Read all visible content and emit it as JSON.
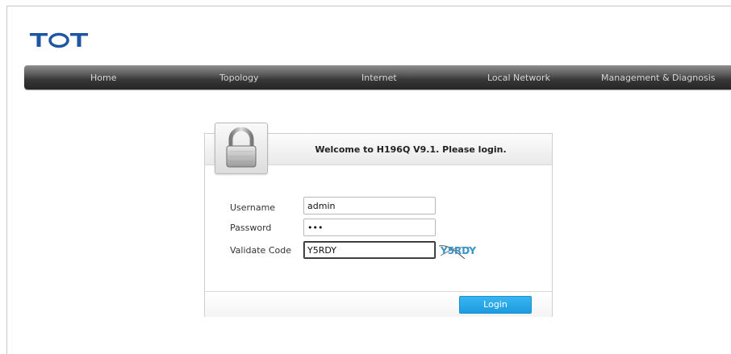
{
  "brand": {
    "logo_text": "TOT",
    "logo_color": "#1e56a3"
  },
  "nav": {
    "home": "Home",
    "topology": "Topology",
    "internet": "Internet",
    "local_network": "Local Network",
    "management": "Management & Diagnosis"
  },
  "login": {
    "title": "Welcome to H196Q V9.1. Please login.",
    "username_label": "Username",
    "username_value": "admin",
    "password_label": "Password",
    "password_value": "•••",
    "code_label": "Validate Code",
    "code_value": "Y5RDY",
    "captcha_text": "Y5RDY",
    "login_button": "Login"
  },
  "colors": {
    "accent": "#1a9ce0",
    "captcha": "#3a94c8",
    "navbar": "#373737"
  }
}
